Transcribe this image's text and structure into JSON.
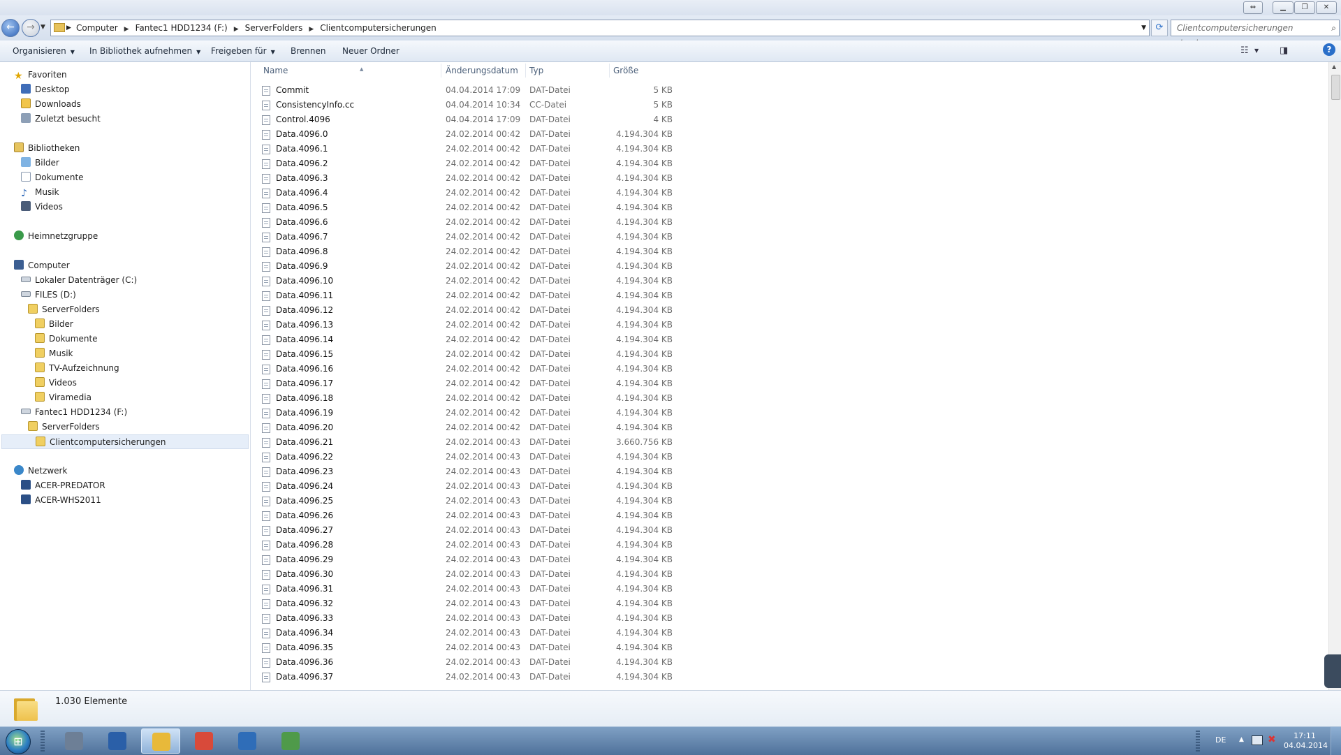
{
  "address": {
    "crumbs": [
      "Computer",
      "Fantec1 HDD1234 (F:)",
      "ServerFolders",
      "Clientcomputersicherungen"
    ]
  },
  "search": {
    "placeholder": "Clientcomputersicherungen durchsuc..."
  },
  "toolbar": {
    "organize": "Organisieren",
    "include_library": "In Bibliothek aufnehmen",
    "share_with": "Freigeben für",
    "burn": "Brennen",
    "new_folder": "Neuer Ordner"
  },
  "nav": {
    "favorites": "Favoriten",
    "desktop": "Desktop",
    "downloads": "Downloads",
    "recent": "Zuletzt besucht",
    "libraries": "Bibliotheken",
    "lib_pictures": "Bilder",
    "lib_documents": "Dokumente",
    "lib_music": "Musik",
    "lib_videos": "Videos",
    "homegroup": "Heimnetzgruppe",
    "computer": "Computer",
    "drive_c": "Lokaler Datenträger (C:)",
    "drive_d": "FILES (D:)",
    "d_serverfolders": "ServerFolders",
    "d_pictures": "Bilder",
    "d_documents": "Dokumente",
    "d_music": "Musik",
    "d_tv": "TV-Aufzeichnung",
    "d_videos": "Videos",
    "d_viramedia": "Viramedia",
    "drive_f": "Fantec1 HDD1234 (F:)",
    "f_serverfolders": "ServerFolders",
    "f_client": "Clientcomputersicherungen",
    "network": "Netzwerk",
    "net_pc1": "ACER-PREDATOR",
    "net_pc2": "ACER-WHS2011"
  },
  "columns": {
    "name": "Name",
    "date": "Änderungsdatum",
    "type": "Typ",
    "size": "Größe"
  },
  "files": [
    {
      "name": "Commit",
      "date": "04.04.2014 17:09",
      "type": "DAT-Datei",
      "size": "5 KB"
    },
    {
      "name": "ConsistencyInfo.cc",
      "date": "04.04.2014 10:34",
      "type": "CC-Datei",
      "size": "5 KB"
    },
    {
      "name": "Control.4096",
      "date": "04.04.2014 17:09",
      "type": "DAT-Datei",
      "size": "4 KB"
    },
    {
      "name": "Data.4096.0",
      "date": "24.02.2014 00:42",
      "type": "DAT-Datei",
      "size": "4.194.304 KB"
    },
    {
      "name": "Data.4096.1",
      "date": "24.02.2014 00:42",
      "type": "DAT-Datei",
      "size": "4.194.304 KB"
    },
    {
      "name": "Data.4096.2",
      "date": "24.02.2014 00:42",
      "type": "DAT-Datei",
      "size": "4.194.304 KB"
    },
    {
      "name": "Data.4096.3",
      "date": "24.02.2014 00:42",
      "type": "DAT-Datei",
      "size": "4.194.304 KB"
    },
    {
      "name": "Data.4096.4",
      "date": "24.02.2014 00:42",
      "type": "DAT-Datei",
      "size": "4.194.304 KB"
    },
    {
      "name": "Data.4096.5",
      "date": "24.02.2014 00:42",
      "type": "DAT-Datei",
      "size": "4.194.304 KB"
    },
    {
      "name": "Data.4096.6",
      "date": "24.02.2014 00:42",
      "type": "DAT-Datei",
      "size": "4.194.304 KB"
    },
    {
      "name": "Data.4096.7",
      "date": "24.02.2014 00:42",
      "type": "DAT-Datei",
      "size": "4.194.304 KB"
    },
    {
      "name": "Data.4096.8",
      "date": "24.02.2014 00:42",
      "type": "DAT-Datei",
      "size": "4.194.304 KB"
    },
    {
      "name": "Data.4096.9",
      "date": "24.02.2014 00:42",
      "type": "DAT-Datei",
      "size": "4.194.304 KB"
    },
    {
      "name": "Data.4096.10",
      "date": "24.02.2014 00:42",
      "type": "DAT-Datei",
      "size": "4.194.304 KB"
    },
    {
      "name": "Data.4096.11",
      "date": "24.02.2014 00:42",
      "type": "DAT-Datei",
      "size": "4.194.304 KB"
    },
    {
      "name": "Data.4096.12",
      "date": "24.02.2014 00:42",
      "type": "DAT-Datei",
      "size": "4.194.304 KB"
    },
    {
      "name": "Data.4096.13",
      "date": "24.02.2014 00:42",
      "type": "DAT-Datei",
      "size": "4.194.304 KB"
    },
    {
      "name": "Data.4096.14",
      "date": "24.02.2014 00:42",
      "type": "DAT-Datei",
      "size": "4.194.304 KB"
    },
    {
      "name": "Data.4096.15",
      "date": "24.02.2014 00:42",
      "type": "DAT-Datei",
      "size": "4.194.304 KB"
    },
    {
      "name": "Data.4096.16",
      "date": "24.02.2014 00:42",
      "type": "DAT-Datei",
      "size": "4.194.304 KB"
    },
    {
      "name": "Data.4096.17",
      "date": "24.02.2014 00:42",
      "type": "DAT-Datei",
      "size": "4.194.304 KB"
    },
    {
      "name": "Data.4096.18",
      "date": "24.02.2014 00:42",
      "type": "DAT-Datei",
      "size": "4.194.304 KB"
    },
    {
      "name": "Data.4096.19",
      "date": "24.02.2014 00:42",
      "type": "DAT-Datei",
      "size": "4.194.304 KB"
    },
    {
      "name": "Data.4096.20",
      "date": "24.02.2014 00:42",
      "type": "DAT-Datei",
      "size": "4.194.304 KB"
    },
    {
      "name": "Data.4096.21",
      "date": "24.02.2014 00:43",
      "type": "DAT-Datei",
      "size": "3.660.756 KB"
    },
    {
      "name": "Data.4096.22",
      "date": "24.02.2014 00:43",
      "type": "DAT-Datei",
      "size": "4.194.304 KB"
    },
    {
      "name": "Data.4096.23",
      "date": "24.02.2014 00:43",
      "type": "DAT-Datei",
      "size": "4.194.304 KB"
    },
    {
      "name": "Data.4096.24",
      "date": "24.02.2014 00:43",
      "type": "DAT-Datei",
      "size": "4.194.304 KB"
    },
    {
      "name": "Data.4096.25",
      "date": "24.02.2014 00:43",
      "type": "DAT-Datei",
      "size": "4.194.304 KB"
    },
    {
      "name": "Data.4096.26",
      "date": "24.02.2014 00:43",
      "type": "DAT-Datei",
      "size": "4.194.304 KB"
    },
    {
      "name": "Data.4096.27",
      "date": "24.02.2014 00:43",
      "type": "DAT-Datei",
      "size": "4.194.304 KB"
    },
    {
      "name": "Data.4096.28",
      "date": "24.02.2014 00:43",
      "type": "DAT-Datei",
      "size": "4.194.304 KB"
    },
    {
      "name": "Data.4096.29",
      "date": "24.02.2014 00:43",
      "type": "DAT-Datei",
      "size": "4.194.304 KB"
    },
    {
      "name": "Data.4096.30",
      "date": "24.02.2014 00:43",
      "type": "DAT-Datei",
      "size": "4.194.304 KB"
    },
    {
      "name": "Data.4096.31",
      "date": "24.02.2014 00:43",
      "type": "DAT-Datei",
      "size": "4.194.304 KB"
    },
    {
      "name": "Data.4096.32",
      "date": "24.02.2014 00:43",
      "type": "DAT-Datei",
      "size": "4.194.304 KB"
    },
    {
      "name": "Data.4096.33",
      "date": "24.02.2014 00:43",
      "type": "DAT-Datei",
      "size": "4.194.304 KB"
    },
    {
      "name": "Data.4096.34",
      "date": "24.02.2014 00:43",
      "type": "DAT-Datei",
      "size": "4.194.304 KB"
    },
    {
      "name": "Data.4096.35",
      "date": "24.02.2014 00:43",
      "type": "DAT-Datei",
      "size": "4.194.304 KB"
    },
    {
      "name": "Data.4096.36",
      "date": "24.02.2014 00:43",
      "type": "DAT-Datei",
      "size": "4.194.304 KB"
    },
    {
      "name": "Data.4096.37",
      "date": "24.02.2014 00:43",
      "type": "DAT-Datei",
      "size": "4.194.304 KB"
    }
  ],
  "status": {
    "item_count": "1.030 Elemente"
  },
  "taskbar": {
    "apps": [
      {
        "icon": "server-manager-icon",
        "color": "#6d7f96"
      },
      {
        "icon": "powershell-icon",
        "color": "#2a5fa8"
      },
      {
        "icon": "explorer-folder-icon",
        "color": "#e8b93a"
      },
      {
        "icon": "chrome-icon",
        "color": "#d84a3a"
      },
      {
        "icon": "remote-desktop-icon",
        "color": "#2f6db8"
      },
      {
        "icon": "dashboard-icon",
        "color": "#4f9a4a"
      }
    ],
    "language": "DE",
    "time": "17:11",
    "date": "04.04.2014"
  }
}
